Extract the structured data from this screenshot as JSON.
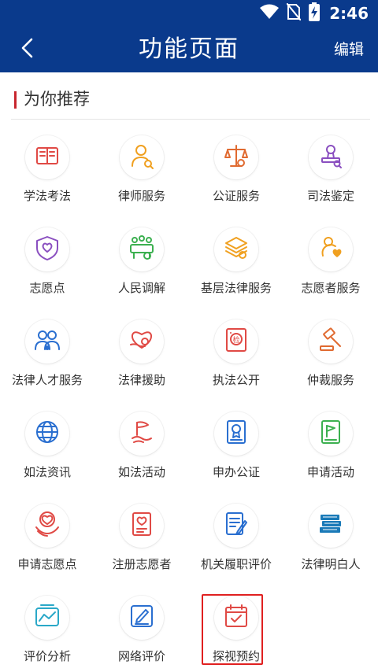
{
  "status_bar": {
    "time": "2:46"
  },
  "nav": {
    "title": "功能页面",
    "edit_label": "编辑"
  },
  "section": {
    "title": "为你推荐"
  },
  "items": [
    {
      "label": "学法考法",
      "icon": "book-icon",
      "color": "#e04a45"
    },
    {
      "label": "律师服务",
      "icon": "lawyer-icon",
      "color": "#f0a020"
    },
    {
      "label": "公证服务",
      "icon": "scales-icon",
      "color": "#e06a30"
    },
    {
      "label": "司法鉴定",
      "icon": "stamp-icon",
      "color": "#8a4fc0"
    },
    {
      "label": "志愿点",
      "icon": "volunteer-shield-icon",
      "color": "#8a4fc0"
    },
    {
      "label": "人民调解",
      "icon": "mediation-icon",
      "color": "#3cb050"
    },
    {
      "label": "基层法律服务",
      "icon": "layers-icon",
      "color": "#f0a020"
    },
    {
      "label": "志愿者服务",
      "icon": "volunteer-heart-icon",
      "color": "#f0a020"
    },
    {
      "label": "法律人才服务",
      "icon": "talent-icon",
      "color": "#2a6fd0"
    },
    {
      "label": "法律援助",
      "icon": "heart-hand-icon",
      "color": "#e04a45"
    },
    {
      "label": "执法公开",
      "icon": "inspection-icon",
      "color": "#e04a45"
    },
    {
      "label": "仲裁服务",
      "icon": "gavel-icon",
      "color": "#e06a30"
    },
    {
      "label": "如法资讯",
      "icon": "globe-icon",
      "color": "#2a6fd0"
    },
    {
      "label": "如法活动",
      "icon": "flag-icon",
      "color": "#e04a45"
    },
    {
      "label": "申办公证",
      "icon": "certificate-icon",
      "color": "#2a6fd0"
    },
    {
      "label": "申请活动",
      "icon": "activity-flag-icon",
      "color": "#3cb050"
    },
    {
      "label": "申请志愿点",
      "icon": "volunteer-hands-icon",
      "color": "#e04a45"
    },
    {
      "label": "注册志愿者",
      "icon": "register-icon",
      "color": "#e04a45"
    },
    {
      "label": "机关履职评价",
      "icon": "document-edit-icon",
      "color": "#2a6fd0"
    },
    {
      "label": "法律明白人",
      "icon": "books-stack-icon",
      "color": "#1a7ab8"
    },
    {
      "label": "评价分析",
      "icon": "analysis-chart-icon",
      "color": "#2aa8c8"
    },
    {
      "label": "网络评价",
      "icon": "pen-board-icon",
      "color": "#2a6fd0"
    },
    {
      "label": "探视预约",
      "icon": "calendar-check-icon",
      "color": "#e04a45"
    }
  ]
}
